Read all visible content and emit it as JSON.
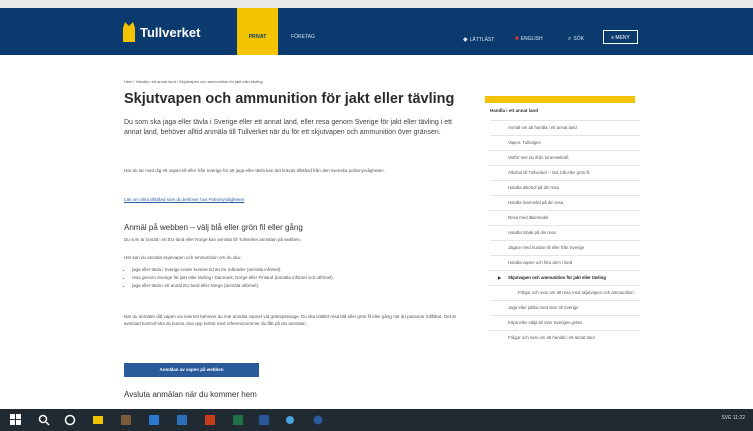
{
  "header": {
    "logo_text": "Tullverket",
    "tab_privat": "PRIVAT",
    "tab_foretag": "FÖRETAG",
    "links": [
      {
        "label": "LÄTTLÄST",
        "icon": "easy-read-icon"
      },
      {
        "label": "ENGLISH",
        "icon": "uk-flag-icon"
      },
      {
        "label": "SÖK",
        "icon": "search-icon"
      }
    ],
    "menu_label": "MENY"
  },
  "breadcrumb": "Hem / Handla i ett annat land / Skjutvapen och ammunition för jakt eller tävling",
  "main": {
    "title": "Skjutvapen och ammunition för jakt eller tävling",
    "lead": "Du som ska jaga eller tävla i Sverige eller ett annat land, eller resa genom Sverige för jakt eller tävling i ett annat land, behöver alltid anmäla till Tullverket när du för ett skjutvapen och ammunition över gränsen.",
    "para1": "Här du tar med dig ett vapen till eller från Sverige för att jaga eller tävla kan det krävas tillstånd från den svenska polismyndigheten.",
    "link": "Läs om vilka tillstånd som du behöver hos Polismyndigheten",
    "h2_a": "Anmäl på webben – välj blå eller grön fil eller gång",
    "para2": "Du som är bosatt i ett EU-land eller Norge kan anmäla till Tullverket anmälan på webben.",
    "para3": "Här kan du anmäla skjutvapen och ammunition om du ska:",
    "bullets": [
      "jaga eller tävla i Sverige under kortare tid än tre månader (anmäla införsel).",
      "resa genom Sverige för jakt eller tävling i Danmark, Norge eller Finland (anmäla införsel och utförsel).",
      "jaga eller tävla i ett annat EU-land eller Norge (anmäla utförsel)."
    ],
    "para4": "När du anmäler ditt vapen via internet behöver du inte anmäla vapnet vid gränspassage. Du ska istället resa blå eller grön fil eller gång när du passerar tullfiltret. Det är avslutad kontroll ska du kunna visa upp kvittot med referensnummer du fått på din anmälan.",
    "cta_label": "Anmälan av vapen på webben",
    "h2_b": "Avsluta anmälan när du kommer hem"
  },
  "sidebar": {
    "head": "Handla i ett annat land",
    "items": [
      "Anmäl om att handla i ett annat land",
      "Vapen. Tullvagen",
      "Varför mer du ifrån tonerstekraft",
      "Alkohol till Tullverket – röd, blå eller grön fil",
      "Handla alkohol på din resa",
      "Handla livsmedel på din resa",
      "Resa med läkemedel",
      "Handla tobak på din resa",
      "Jägare med hundar till eller från Sverige",
      "Handla vapen och föra dem i land"
    ],
    "active": "Skjutvapen och ammunition för jakt eller tävling",
    "sub": "Frågor och svar om att resa med skjutvapen och ammunition",
    "after": [
      "Jaga eller jobba med dem till Sverige",
      "Köpa eller sälja bil över Sveriges gräns",
      "Frågor och svar om att handla i ett annat land"
    ]
  },
  "taskbar": {
    "tray": "SVE  11:22"
  },
  "colors": {
    "header": "#0b3b6e",
    "accent": "#f2c300",
    "link": "#2a5a9a"
  }
}
